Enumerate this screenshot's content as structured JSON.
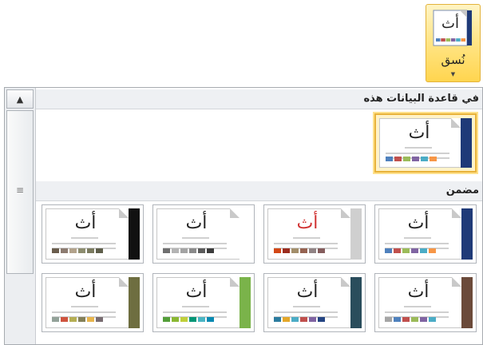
{
  "ribbon": {
    "themes_button": {
      "label": "نُسق",
      "glyph": "أث",
      "icon": "themes-icon",
      "swatches": [
        "#4f81bd",
        "#c0504d",
        "#9bbb59",
        "#8064a2",
        "#4bacc6",
        "#f79646"
      ]
    },
    "dropdown_icon": "chevron-down-icon"
  },
  "gallery": {
    "scrollbar": {
      "up_icon": "scroll-up-arrow-icon",
      "thumb_icon": "scroll-grip-icon"
    },
    "section_this_database": {
      "title": "في قاعدة البيانات هذه",
      "themes": [
        {
          "glyph": "أث",
          "glyph_color": "#222222",
          "side": "#1f3a78",
          "swatches": [
            "#4f81bd",
            "#c0504d",
            "#9bbb59",
            "#8064a2",
            "#4bacc6",
            "#f79646"
          ],
          "selected": true
        }
      ]
    },
    "section_builtin": {
      "title": "مضمن",
      "themes": [
        {
          "glyph": "أث",
          "glyph_color": "#222222",
          "side": "#1f3a78",
          "swatches": [
            "#4f81bd",
            "#c0504d",
            "#9bbb59",
            "#8064a2",
            "#4bacc6",
            "#f79646"
          ]
        },
        {
          "glyph": "أث",
          "glyph_color": "#d03030",
          "side": "#cfcfcf",
          "swatches": [
            "#d34817",
            "#9b2d1f",
            "#a28e6a",
            "#956251",
            "#918485",
            "#855d5d"
          ]
        },
        {
          "glyph": "أث",
          "glyph_color": "#222222",
          "side": "#ffffff",
          "swatches": [
            "#6f6f6f",
            "#b3b3b3",
            "#a3a3a3",
            "#8a8a8a",
            "#5b5b5b",
            "#3c3c3c"
          ]
        },
        {
          "glyph": "أث",
          "glyph_color": "#222222",
          "side": "#111111",
          "swatches": [
            "#6a5d4d",
            "#8c7b70",
            "#b2a28b",
            "#8c8c6e",
            "#7b7b60",
            "#5e5e4a"
          ]
        },
        {
          "glyph": "أث",
          "glyph_color": "#222222",
          "side": "#6b4a3a",
          "swatches": [
            "#a5a5a5",
            "#4f81bd",
            "#c0504d",
            "#9bbb59",
            "#8064a2",
            "#4bacc6"
          ]
        },
        {
          "glyph": "أث",
          "glyph_color": "#222222",
          "side": "#2a4d5c",
          "swatches": [
            "#2c7c9f",
            "#e4a729",
            "#4bacc6",
            "#c0504d",
            "#8064a2",
            "#244482"
          ]
        },
        {
          "glyph": "أث",
          "glyph_color": "#222222",
          "side": "#7ab34a",
          "swatches": [
            "#549e39",
            "#8ab833",
            "#c0cf3a",
            "#029676",
            "#4ab5c4",
            "#0989b1"
          ]
        },
        {
          "glyph": "أث",
          "glyph_color": "#222222",
          "side": "#6e6e40",
          "swatches": [
            "#93a299",
            "#cf543f",
            "#b5ae53",
            "#848058",
            "#e8b54d",
            "#786c71"
          ]
        }
      ]
    }
  }
}
